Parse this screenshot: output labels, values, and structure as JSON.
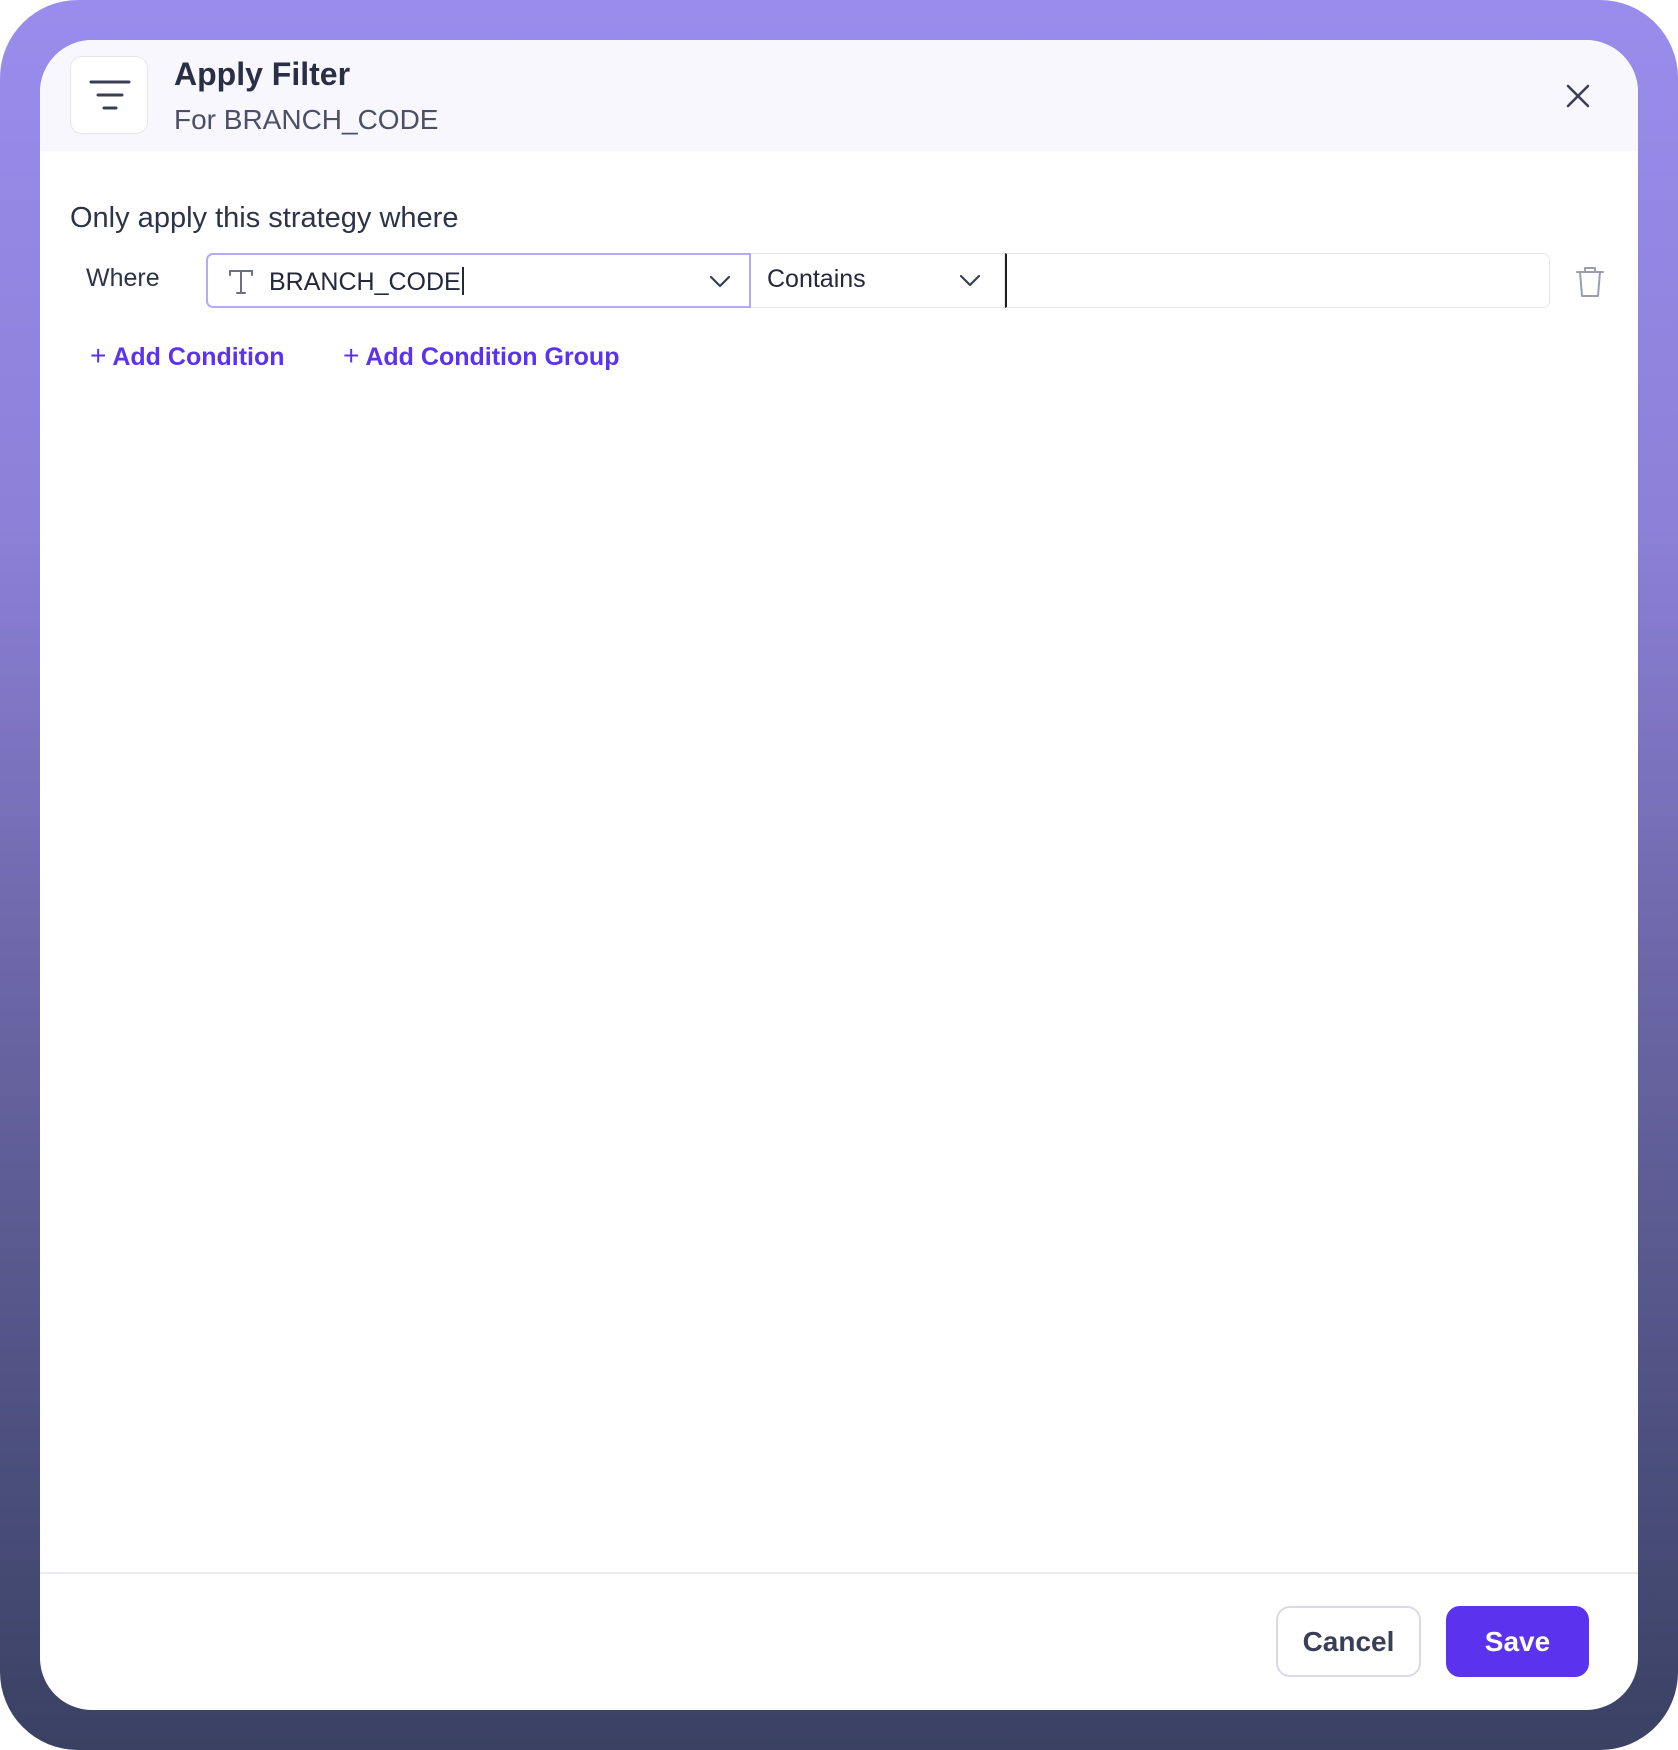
{
  "dialog": {
    "title": "Apply Filter",
    "subtitle": "For BRANCH_CODE",
    "header_icon": "filter-lines-icon",
    "close_icon": "close-icon"
  },
  "filter": {
    "section_label": "Only apply this strategy where",
    "condition": {
      "prefix": "Where",
      "field_icon": "text-type-icon",
      "field_value": "BRANCH_CODE",
      "operator": "Contains",
      "value": "",
      "delete_icon": "trash-icon"
    },
    "add_condition_label": "Add Condition",
    "add_group_label": "Add Condition Group",
    "add_icon": "plus-icon"
  },
  "footer": {
    "cancel_label": "Cancel",
    "save_label": "Save"
  },
  "colors": {
    "accent": "#5b33ee",
    "focus_border": "#b7a9f4",
    "header_bg": "#f8f7fd",
    "frame_top": "#9a8cec",
    "frame_bottom": "#3a4163"
  }
}
